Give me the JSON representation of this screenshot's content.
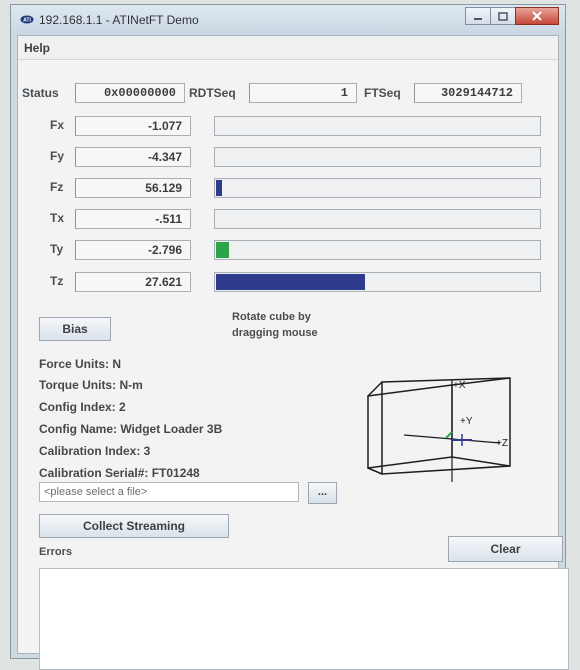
{
  "window": {
    "title": "192.168.1.1 - ATINetFT Demo"
  },
  "menu": {
    "help": "Help"
  },
  "header": {
    "status_label": "Status",
    "status_value": "0x00000000",
    "rdtseq_label": "RDTSeq",
    "rdtseq_value": "1",
    "ftseq_label": "FTSeq",
    "ftseq_value": "3029144712"
  },
  "axes": [
    {
      "label": "Fx",
      "value": "-1.077",
      "bar_level": 0.0,
      "bar_color": "#2e3a8c"
    },
    {
      "label": "Fy",
      "value": "-4.347",
      "bar_level": 0.0,
      "bar_color": "#2e3a8c"
    },
    {
      "label": "Fz",
      "value": "56.129",
      "bar_level": 0.02,
      "bar_color": "#2e3a8c"
    },
    {
      "label": "Tx",
      "value": "-.511",
      "bar_level": 0.0,
      "bar_color": "#2e3a8c"
    },
    {
      "label": "Ty",
      "value": "-2.796",
      "bar_level": 0.04,
      "bar_color": "#2fa34a"
    },
    {
      "label": "Tz",
      "value": "27.621",
      "bar_level": 0.46,
      "bar_color": "#2e3a8c"
    }
  ],
  "controls": {
    "bias_label": "Bias",
    "rotate_hint_line1": "Rotate cube by",
    "rotate_hint_line2": "dragging mouse",
    "file_placeholder": "<please select a file>",
    "browse_label": "...",
    "collect_label": "Collect Streaming",
    "clear_label": "Clear",
    "errors_label": "Errors"
  },
  "info": {
    "force_units": "Force Units: N",
    "torque_units": "Torque Units: N-m",
    "config_index": "Config Index: 2",
    "config_name": "Config Name: Widget Loader 3B",
    "calibration_index": "Calibration Index: 3",
    "calibration_serial": "Calibration Serial#: FT01248"
  },
  "cube": {
    "axis_x": "+X",
    "axis_y": "+Y",
    "axis_z": "+Z"
  },
  "icons": {
    "app": "ati-logo-icon",
    "minimize": "minimize-icon",
    "maximize": "maximize-icon",
    "close": "close-icon"
  }
}
